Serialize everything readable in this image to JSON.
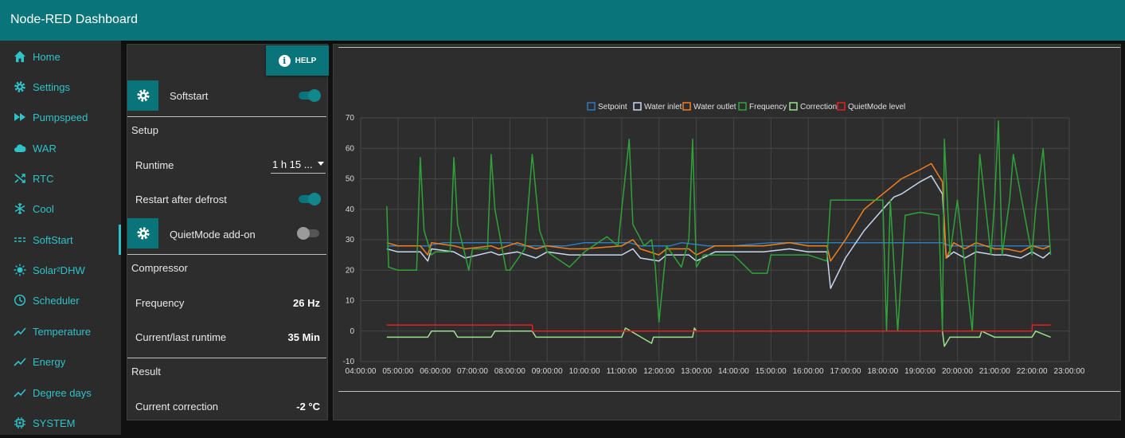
{
  "header": {
    "title": "Node-RED Dashboard"
  },
  "sidebar": {
    "items": [
      {
        "label": "Home",
        "icon": "home-icon"
      },
      {
        "label": "Settings",
        "icon": "gear-icon"
      },
      {
        "label": "Pumpspeed",
        "icon": "fast-forward-icon"
      },
      {
        "label": "WAR",
        "icon": "cloud-icon"
      },
      {
        "label": "RTC",
        "icon": "shuffle-icon"
      },
      {
        "label": "Cool",
        "icon": "snowflake-icon"
      },
      {
        "label": "SoftStart",
        "icon": "dashes-icon"
      },
      {
        "label": "Solar²DHW",
        "icon": "sun-icon"
      },
      {
        "label": "Scheduler",
        "icon": "clock-icon"
      },
      {
        "label": "Temperature",
        "icon": "trend-icon"
      },
      {
        "label": "Energy",
        "icon": "trend-icon"
      },
      {
        "label": "Degree days",
        "icon": "trend-icon"
      },
      {
        "label": "SYSTEM",
        "icon": "chip-icon"
      }
    ],
    "active": "SoftStart"
  },
  "panel": {
    "help_label": "HELP",
    "softstart_label": "Softstart",
    "setup_label": "Setup",
    "runtime_label": "Runtime",
    "runtime_value": "1 h 15 ...",
    "restart_label": "Restart after defrost",
    "quietmode_label": "QuietMode add-on",
    "compressor_label": "Compressor",
    "frequency_label": "Frequency",
    "frequency_value": "26 Hz",
    "runtime_last_label": "Current/last runtime",
    "runtime_last_value": "35 Min",
    "result_label": "Result",
    "correction_label": "Current correction",
    "correction_value": "-2 °C"
  },
  "colors": {
    "accent": "#097479",
    "nav_text": "#2fc3c8",
    "setpoint": "#2b7bbf",
    "water_inlet": "#c8d6ee",
    "water_outlet": "#f07f1d",
    "frequency": "#2fa33a",
    "correction": "#9ce28e",
    "quietmode": "#e02222"
  },
  "chart_data": {
    "type": "line",
    "legend": [
      "Setpoint",
      "Water inlet",
      "Water outlet",
      "Frequency",
      "Correction",
      "QuietMode level"
    ],
    "legend_position": "top",
    "x_ticks": [
      "04:00:00",
      "05:00:00",
      "06:00:00",
      "07:00:00",
      "08:00:00",
      "09:00:00",
      "10:00:00",
      "11:00:00",
      "12:00:00",
      "13:00:00",
      "14:00:00",
      "15:00:00",
      "16:00:00",
      "17:00:00",
      "18:00:00",
      "19:00:00",
      "20:00:00",
      "21:00:00",
      "22:00:00",
      "23:00:00"
    ],
    "xlim_hours": [
      4,
      23
    ],
    "ylim": [
      -10,
      70
    ],
    "y_ticks": [
      -10,
      0,
      10,
      20,
      30,
      40,
      50,
      60,
      70
    ],
    "grid": true,
    "series": [
      {
        "name": "Setpoint",
        "x": [
          4.7,
          5.8,
          6.2,
          8.0,
          8.3,
          9.5,
          10.0,
          11.2,
          11.5,
          12.3,
          12.6,
          13.3,
          14.0,
          15.0,
          15.5,
          16.5,
          19.6,
          19.8,
          20.5,
          22.5
        ],
        "y": [
          28,
          28,
          29,
          29,
          28,
          28,
          29,
          29,
          28,
          28,
          29,
          28,
          28,
          29,
          29,
          29,
          29,
          28,
          28,
          28
        ]
      },
      {
        "name": "Water inlet",
        "x": [
          4.7,
          5.0,
          5.6,
          5.8,
          5.9,
          6.5,
          6.8,
          7.5,
          7.7,
          8.2,
          8.7,
          9.0,
          9.6,
          10.0,
          11.0,
          11.3,
          11.5,
          12.0,
          12.2,
          12.8,
          13.0,
          13.5,
          14.0,
          14.8,
          15.5,
          16.0,
          16.5,
          16.6,
          17.0,
          17.5,
          18.0,
          18.3,
          18.5,
          19.0,
          19.3,
          19.6,
          19.7,
          19.9,
          20.2,
          20.5,
          21.0,
          21.3,
          21.7,
          22.0,
          22.3,
          22.5
        ],
        "y": [
          27,
          26,
          26,
          23,
          27,
          26,
          24,
          26,
          25,
          26,
          24,
          26,
          25,
          25,
          25,
          27,
          24,
          23,
          25,
          25,
          23,
          26,
          26,
          26,
          27,
          26,
          26,
          14,
          24,
          33,
          40,
          44,
          45,
          49,
          51,
          45,
          24,
          26,
          24,
          26,
          25,
          25,
          24,
          26,
          24,
          26
        ]
      },
      {
        "name": "Water outlet",
        "x": [
          4.7,
          5.0,
          5.6,
          5.8,
          5.9,
          6.5,
          6.8,
          7.5,
          7.7,
          8.2,
          8.7,
          9.0,
          9.6,
          10.0,
          11.0,
          11.3,
          11.5,
          12.0,
          12.2,
          12.8,
          13.0,
          13.5,
          14.0,
          14.8,
          15.5,
          16.0,
          16.5,
          16.6,
          17.0,
          17.5,
          18.0,
          18.3,
          18.5,
          19.0,
          19.3,
          19.6,
          19.7,
          19.9,
          20.2,
          20.5,
          21.0,
          21.3,
          21.7,
          22.0,
          22.3,
          22.5
        ],
        "y": [
          29,
          28,
          28,
          25,
          29,
          28,
          27,
          28,
          27,
          29,
          27,
          28,
          27,
          27,
          28,
          30,
          27,
          25,
          27,
          27,
          25,
          28,
          28,
          28,
          29,
          28,
          28,
          23,
          30,
          40,
          45,
          48,
          50,
          53,
          55,
          49,
          24,
          29,
          27,
          29,
          27,
          27,
          26,
          28,
          27,
          28
        ]
      },
      {
        "name": "Frequency",
        "x": [
          4.7,
          4.75,
          5.0,
          5.5,
          5.6,
          5.7,
          5.9,
          6.0,
          6.4,
          6.5,
          6.6,
          6.9,
          7.0,
          7.4,
          7.5,
          7.6,
          7.9,
          8.0,
          8.4,
          8.6,
          8.8,
          9.0,
          9.6,
          10.0,
          10.6,
          10.9,
          11.0,
          11.2,
          11.3,
          11.6,
          11.8,
          11.9,
          12.0,
          12.2,
          12.6,
          12.8,
          12.9,
          13.0,
          13.2,
          13.5,
          14.0,
          14.5,
          14.9,
          15.0,
          15.5,
          16.0,
          16.5,
          16.6,
          17.0,
          18.0,
          18.1,
          18.2,
          18.4,
          18.6,
          19.0,
          19.5,
          19.6,
          19.65,
          19.8,
          20.0,
          20.4,
          20.6,
          20.9,
          21.0,
          21.1,
          21.2,
          21.4,
          21.5,
          22.0,
          22.1,
          22.3,
          22.5
        ],
        "y": [
          41,
          21,
          20,
          20,
          57,
          33,
          25,
          26,
          26,
          57,
          35,
          20,
          27,
          27,
          58,
          40,
          20,
          20,
          27,
          58,
          33,
          26,
          21,
          26,
          31,
          28,
          40,
          63,
          35,
          28,
          30,
          21,
          3,
          28,
          21,
          30,
          63,
          21,
          25,
          25,
          25,
          19,
          19,
          25,
          25,
          25,
          23,
          43,
          43,
          43,
          0,
          43,
          0,
          38,
          39,
          38,
          0,
          63,
          25,
          43,
          0,
          58,
          25,
          43,
          69,
          25,
          43,
          58,
          25,
          40,
          60,
          25
        ]
      },
      {
        "name": "Correction",
        "x": [
          4.7,
          5.8,
          5.9,
          6.5,
          6.6,
          7.5,
          7.6,
          8.6,
          8.7,
          11.0,
          11.1,
          11.8,
          11.85,
          12.0,
          12.9,
          12.95,
          13.0,
          19.6,
          19.65,
          19.8,
          20.6,
          20.65,
          21.0,
          22.0,
          22.1,
          22.5
        ],
        "y": [
          -2,
          -2,
          0,
          0,
          -2,
          -2,
          0,
          0,
          -2,
          -2,
          1,
          -4,
          -2,
          -2,
          -2,
          1,
          0,
          0,
          -5,
          -2,
          -2,
          0,
          -2,
          -2,
          0,
          -2
        ]
      },
      {
        "name": "QuietMode level",
        "x": [
          4.7,
          8.6,
          8.61,
          22.0,
          22.01,
          22.5
        ],
        "y": [
          2,
          2,
          0,
          0,
          2,
          2
        ]
      }
    ]
  }
}
